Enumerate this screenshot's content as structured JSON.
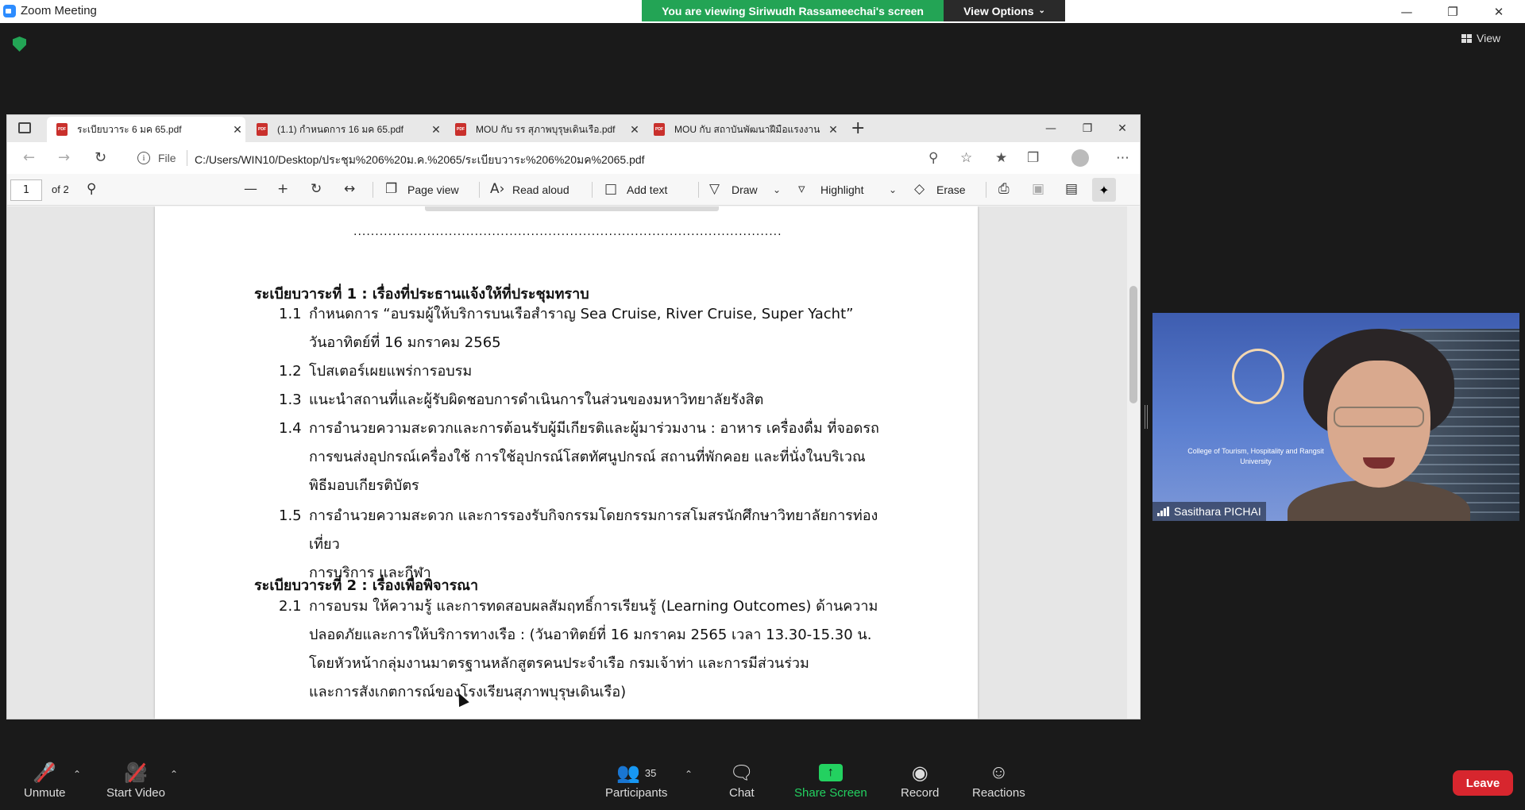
{
  "zoom": {
    "title": "Zoom Meeting",
    "viewing_banner": "You are viewing Siriwudh Rassameechai's screen",
    "view_options": "View Options",
    "view_label": "View"
  },
  "browser": {
    "tabs": [
      {
        "label": "ระเบียบวาระ 6 มค 65.pdf",
        "active": true
      },
      {
        "label": "(1.1) กำหนดการ 16 มค 65.pdf",
        "active": false
      },
      {
        "label": "MOU กับ รร สุภาพบุรุษเดินเรือ.pdf",
        "active": false
      },
      {
        "label": "MOU กับ สถาบันพัฒนาฝีมือแรงงาน",
        "active": false
      }
    ],
    "file_label": "File",
    "url": "C:/Users/WIN10/Desktop/ประชุม%206%20ม.ค.%2065/ระเบียบวาระ%206%20มค%2065.pdf"
  },
  "pdf_toolbar": {
    "page_number": "1",
    "page_count": "of 2",
    "page_view": "Page view",
    "read_aloud": "Read aloud",
    "add_text": "Add text",
    "draw": "Draw",
    "highlight": "Highlight",
    "erase": "Erase"
  },
  "document": {
    "agenda1_heading": "ระเบียบวาระที่ 1 : เรื่องที่ประธานแจ้งให้ที่ประชุมทราบ",
    "agenda1_items": [
      {
        "num": "1.1",
        "lines": [
          "กำหนดการ “อบรมผู้ให้บริการบนเรือสำราญ Sea Cruise, River Cruise, Super Yacht”",
          "วันอาทิตย์ที่ 16 มกราคม 2565"
        ]
      },
      {
        "num": "1.2",
        "lines": [
          "โปสเตอร์เผยแพร่การอบรม"
        ]
      },
      {
        "num": "1.3",
        "lines": [
          "แนะนำสถานที่และผู้รับผิดชอบการดำเนินการในส่วนของมหาวิทยาลัยรังสิต"
        ]
      },
      {
        "num": "1.4",
        "lines": [
          "การอำนวยความสะดวกและการต้อนรับผู้มีเกียรติและผู้มาร่วมงาน : อาหาร เครื่องดื่ม ที่จอดรถ",
          "การขนส่งอุปกรณ์เครื่องใช้ การใช้อุปกรณ์โสตทัศนูปกรณ์ สถานที่พักคอย และที่นั่งในบริเวณ",
          "พิธีมอบเกียรติบัตร"
        ]
      },
      {
        "num": "1.5",
        "lines": [
          "การอำนวยความสะดวก และการรองรับกิจกรรมโดยกรรมการสโมสรนักศึกษาวิทยาลัยการท่องเที่ยว",
          "การบริการ และกีฬา"
        ]
      }
    ],
    "agenda2_heading": "ระเบียบวาระที่ 2 : เรื่องเพื่อพิจารณา",
    "agenda2_items": [
      {
        "num": "2.1",
        "lines": [
          "การอบรม ให้ความรู้ และการทดสอบผลสัมฤทธิ์การเรียนรู้ (Learning Outcomes) ด้านความ",
          "ปลอดภัยและการให้บริการทางเรือ : (วันอาทิตย์ที่ 16 มกราคม 2565 เวลา 13.30-15.30 น.",
          "โดยหัวหน้ากลุ่มงานมาตรฐานหลักสูตรคนประจำเรือ กรมเจ้าท่า และการมีส่วนร่วม",
          "และการสังเกตการณ์ของโรงเรียนสุภาพบุรุษเดินเรือ)"
        ]
      }
    ]
  },
  "video": {
    "participant_name": "Sasithara PICHAI",
    "college_text": "College of Tourism, Hospitality and Rangsit University"
  },
  "toolbar": {
    "unmute": "Unmute",
    "start_video": "Start Video",
    "participants": "Participants",
    "participants_count": "35",
    "chat": "Chat",
    "share_screen": "Share Screen",
    "record": "Record",
    "reactions": "Reactions",
    "leave": "Leave"
  },
  "colors": {
    "banner_green": "#23a455",
    "share_green": "#23d160",
    "leave_red": "#d7262e"
  }
}
